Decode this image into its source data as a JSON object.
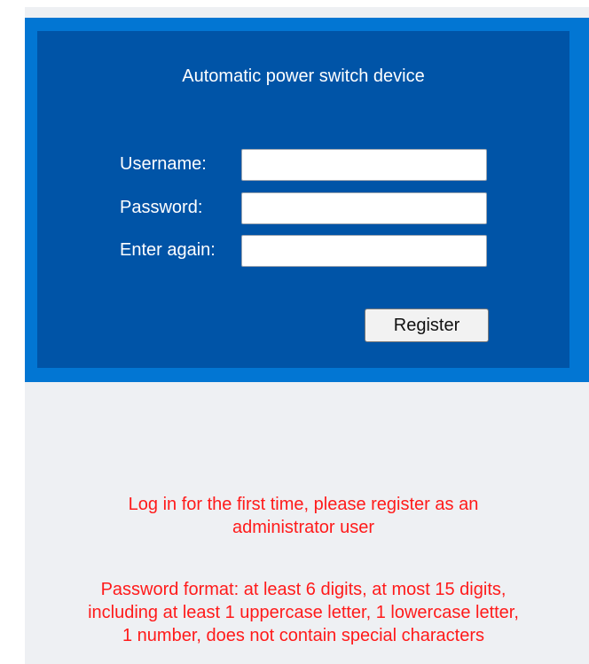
{
  "form": {
    "title": "Automatic power switch device",
    "username_label": "Username:",
    "username_value": "",
    "password_label": "Password:",
    "password_value": "",
    "confirm_label": "Enter again:",
    "confirm_value": "",
    "register_label": "Register"
  },
  "notices": {
    "first_login_line1": "Log in for the first time, please register as an",
    "first_login_line2": "administrator user",
    "password_format_line1": "Password format: at least 6 digits, at most 15 digits,",
    "password_format_line2": "including at least 1 uppercase letter, 1 lowercase letter,",
    "password_format_line3": "1 number, does not contain special characters"
  },
  "colors": {
    "panel_border": "#0276d3",
    "panel_fill": "#0054a7",
    "page_background": "#eef0f3",
    "notice_text": "#ff1a1a"
  }
}
